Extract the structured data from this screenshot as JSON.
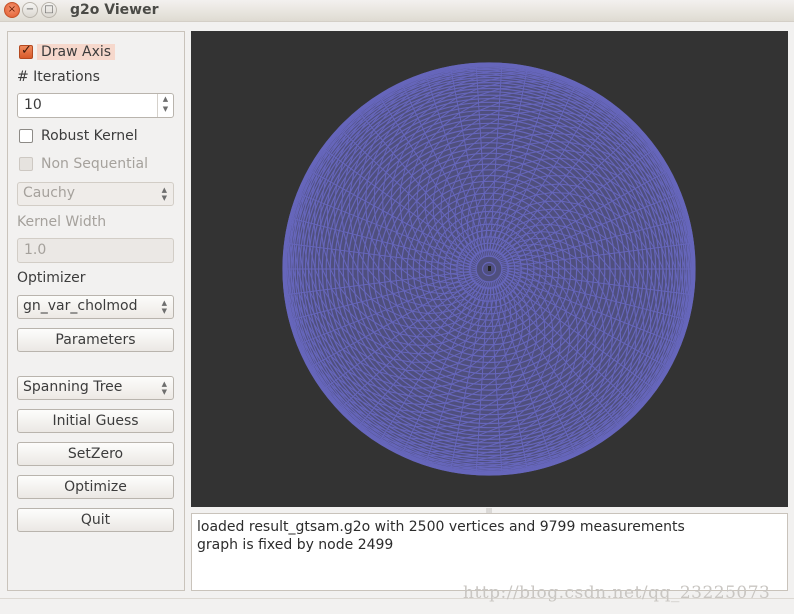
{
  "window": {
    "title": "g2o Viewer",
    "controls": {
      "close": "×",
      "minimize": "−",
      "maximize": "□"
    }
  },
  "sidebar": {
    "draw_axis": {
      "label": "Draw Axis",
      "checked": true
    },
    "iterations": {
      "label": "# Iterations",
      "value": "10"
    },
    "robust_kernel": {
      "label": "Robust Kernel",
      "checked": false
    },
    "non_sequential": {
      "label": "Non Sequential",
      "checked": false,
      "disabled": true
    },
    "kernel_type": {
      "selected": "Cauchy",
      "disabled": true
    },
    "kernel_width": {
      "label": "Kernel Width",
      "value": "1.0",
      "disabled": true
    },
    "optimizer": {
      "label": "Optimizer",
      "selected": "gn_var_cholmod"
    },
    "parameters_button": "Parameters",
    "initial_guess_type": {
      "selected": "Spanning Tree"
    },
    "initial_guess_button": "Initial Guess",
    "set_zero_button": "SetZero",
    "optimize_button": "Optimize",
    "quit_button": "Quit"
  },
  "viewer": {
    "background_color": "#333333",
    "graph_color": "#6666bb",
    "vertices": 2500,
    "measurements": 9799
  },
  "log": {
    "lines": [
      "loaded result_gtsam.g2o with 2500 vertices and 9799 measurements",
      "graph is fixed by node 2499"
    ]
  },
  "watermark": "http://blog.csdn.net/qq_23225073"
}
